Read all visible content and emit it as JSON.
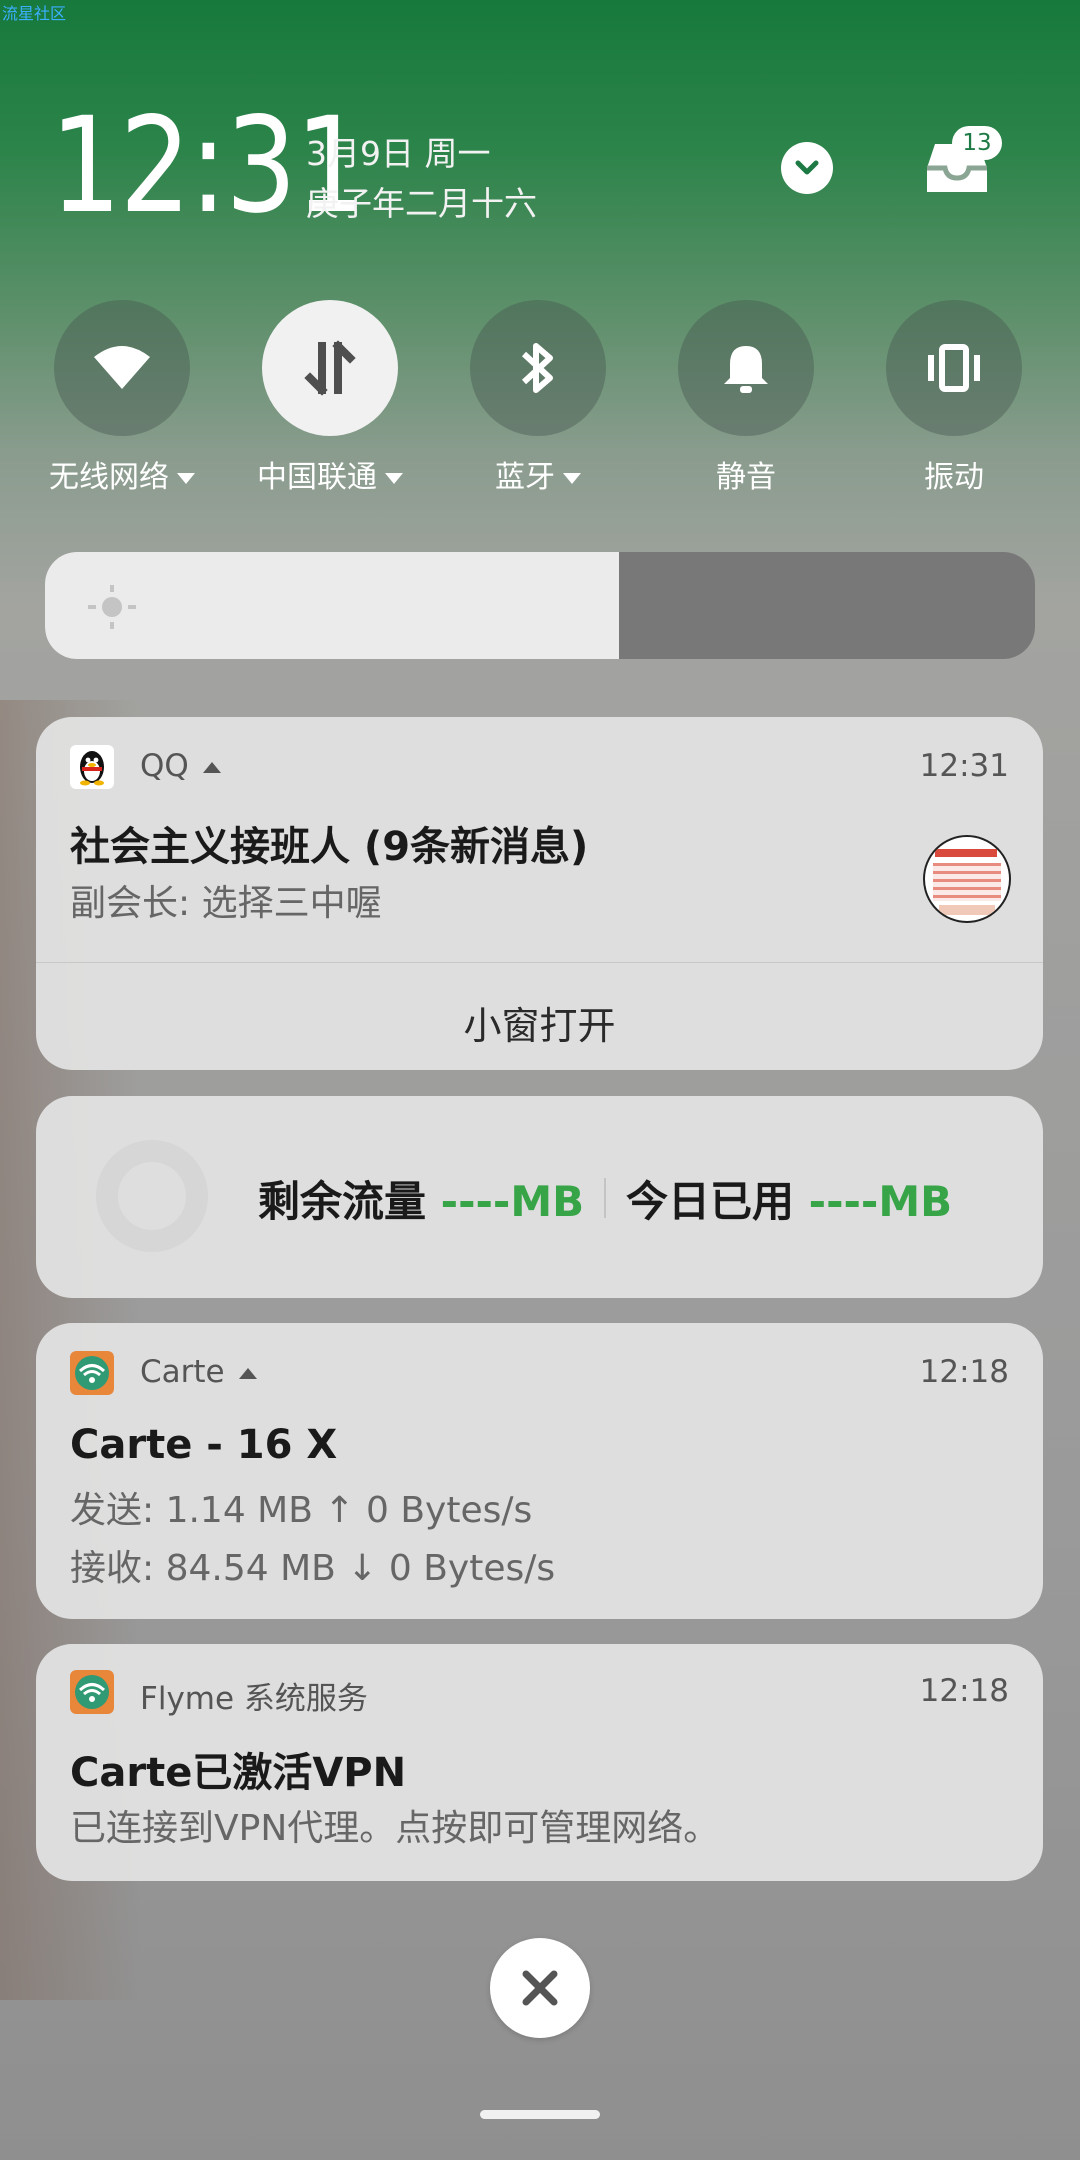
{
  "watermark": "流星社区",
  "status": {
    "time": "12:31",
    "date": "3月9日 周一",
    "lunar_date": "庚子年二月十六",
    "notification_count": "13"
  },
  "quick_settings": [
    {
      "label": "无线网络",
      "icon": "wifi-icon",
      "active": false,
      "has_menu": true
    },
    {
      "label": "中国联通",
      "icon": "mobile-data-icon",
      "active": true,
      "has_menu": true
    },
    {
      "label": "蓝牙",
      "icon": "bluetooth-icon",
      "active": false,
      "has_menu": true
    },
    {
      "label": "静音",
      "icon": "bell-icon",
      "active": false,
      "has_menu": false
    },
    {
      "label": "振动",
      "icon": "vibrate-icon",
      "active": false,
      "has_menu": false
    }
  ],
  "brightness": {
    "level": 0.58,
    "icon": "brightness-icon"
  },
  "notifications": [
    {
      "app": "QQ",
      "icon": "qq-penguin-icon",
      "time": "12:31",
      "title": "社会主义接班人 (9条新消息)",
      "text": "副会长: 选择三中喔",
      "action": "小窗打开"
    },
    {
      "type": "data-usage",
      "remaining_label": "剩余流量",
      "remaining_value": "----MB",
      "today_label": "今日已用",
      "today_value": "----MB"
    },
    {
      "app": "Carte",
      "icon": "carte-wifi-icon",
      "time": "12:18",
      "title": "Carte - 16 X",
      "line1": "发送: 1.14 MB ↑ 0 Bytes/s",
      "line2": "接收: 84.54 MB ↓ 0 Bytes/s"
    },
    {
      "app": "Flyme 系统服务",
      "icon": "carte-wifi-icon",
      "time": "12:18",
      "title": "Carte已激活VPN",
      "text": "已连接到VPN代理。点按即可管理网络。"
    }
  ],
  "colors": {
    "accent_green": "#36a447",
    "header_green": "#17793c"
  }
}
